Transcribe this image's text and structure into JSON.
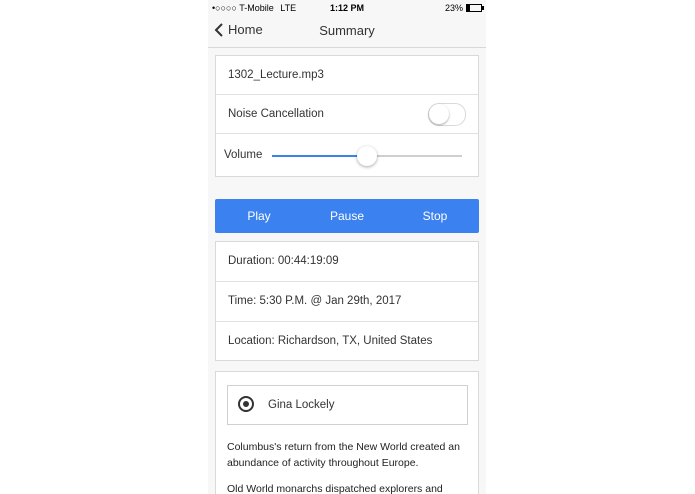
{
  "status_bar": {
    "carrier": "•○○○○ T-Mobile",
    "network": "LTE",
    "time": "1:12 PM",
    "battery": "23%",
    "battery_level": 0.23
  },
  "nav": {
    "back_label": "Home",
    "title": "Summary"
  },
  "audio": {
    "file_name": "1302_Lecture.mp3",
    "noise_label": "Noise Cancellation",
    "noise_enabled": false,
    "volume_label": "Volume",
    "volume_level": 0.5
  },
  "controls": {
    "play": "Play",
    "pause": "Pause",
    "stop": "Stop"
  },
  "info": {
    "duration": "Duration: 00:44:19:09",
    "time": "Time: 5:30 P.M. @ Jan 29th, 2017",
    "location": "Location: Richardson, TX, United States"
  },
  "transcript": {
    "speaker": "Gina Lockely",
    "paragraphs": [
      "Columbus's return from the New World created an abundance of activity throughout Europe.",
      "Old World monarchs dispatched explorers and"
    ]
  },
  "colors": {
    "accent": "#3b82f0"
  }
}
